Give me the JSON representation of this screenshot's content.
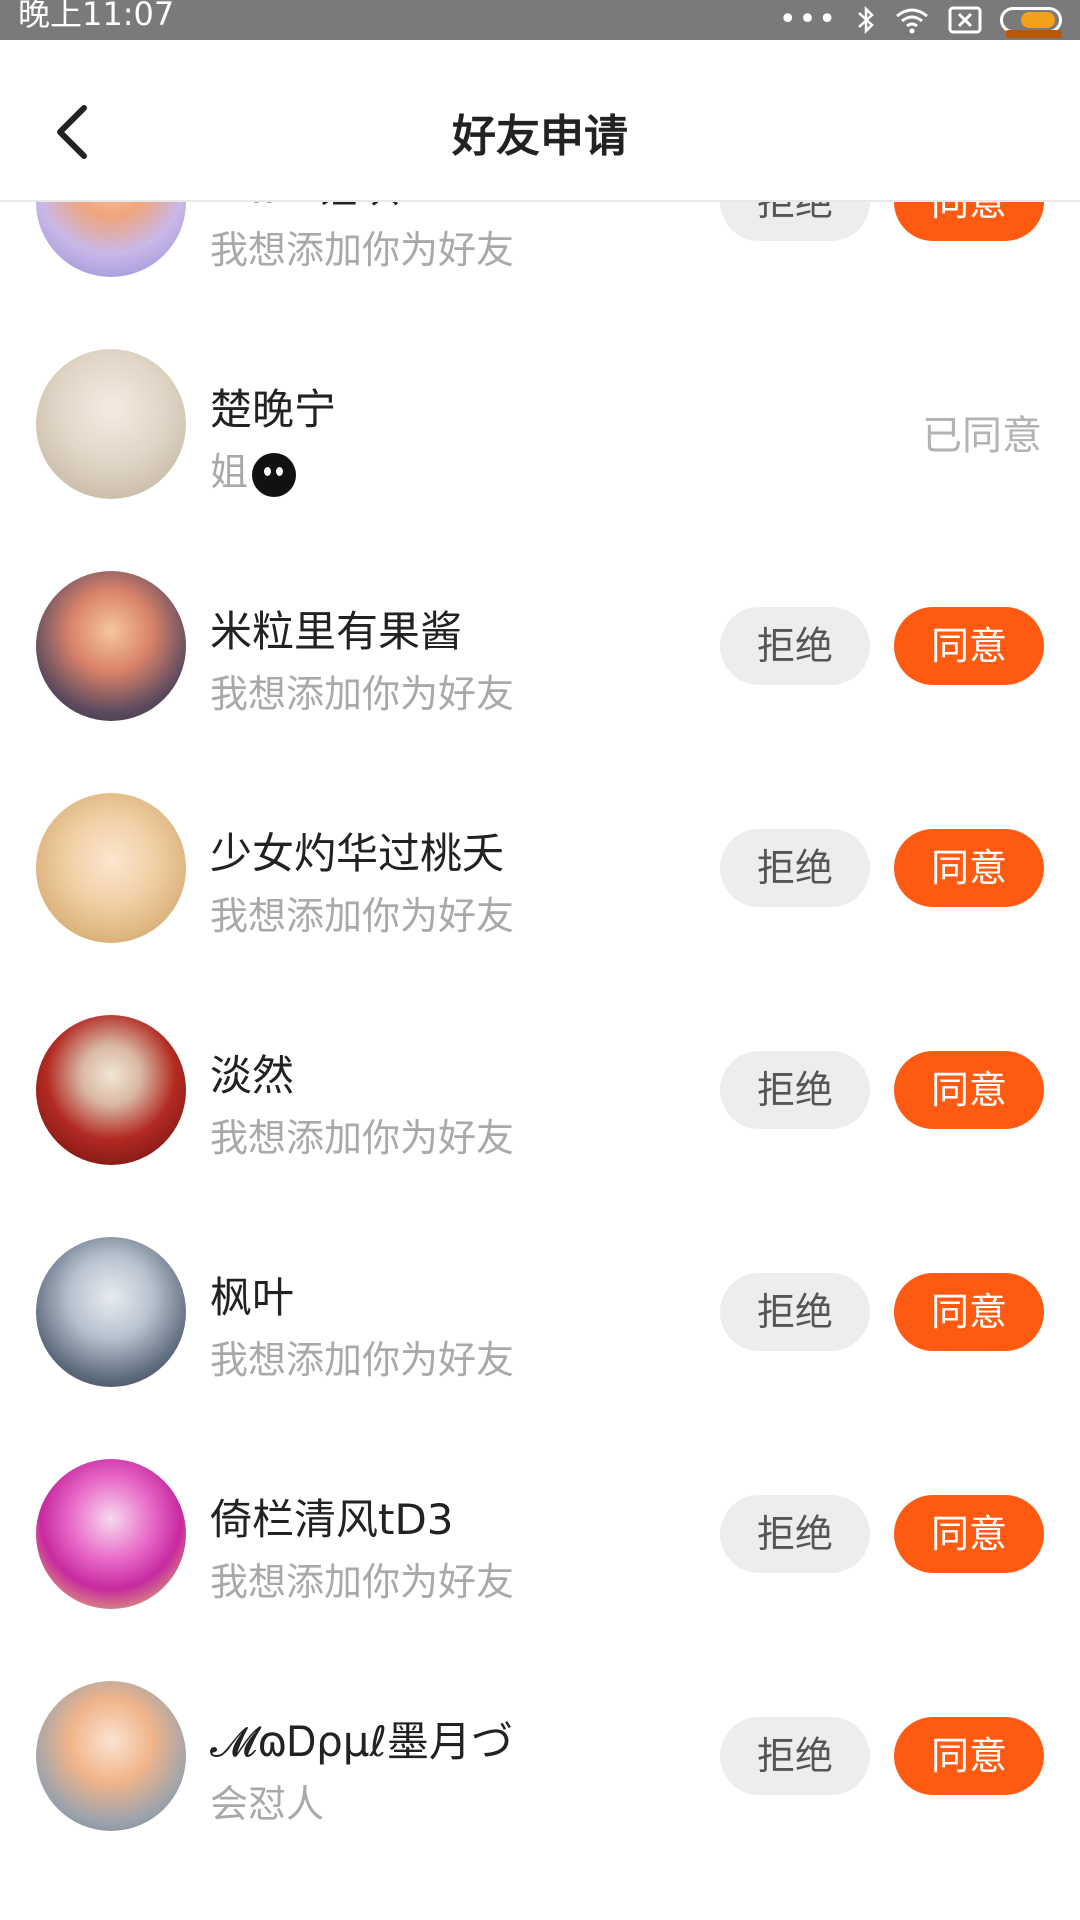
{
  "status_bar": {
    "time": "晚上11:07",
    "dots": "•••"
  },
  "header": {
    "title": "好友申请"
  },
  "labels": {
    "reject": "拒绝",
    "agree": "同意"
  },
  "requests": [
    {
      "name": "^ω^锂琪",
      "message": "我想添加你为好友",
      "status": "pending"
    },
    {
      "name": "楚晚宁",
      "message": "姐",
      "status": "已同意"
    },
    {
      "name": "米粒里有果酱",
      "message": "我想添加你为好友",
      "status": "pending"
    },
    {
      "name": "少女灼华过桃夭",
      "message": "我想添加你为好友",
      "status": "pending"
    },
    {
      "name": "淡然",
      "message": "我想添加你为好友",
      "status": "pending"
    },
    {
      "name": "枫叶",
      "message": "我想添加你为好友",
      "status": "pending"
    },
    {
      "name": "倚栏清风tD3",
      "message": "我想添加你为好友",
      "status": "pending"
    },
    {
      "name": "𝓜ɷᎠρμℓ墨月づ",
      "message": "会怼人",
      "status": "pending"
    }
  ],
  "colors": {
    "accent": "#ff5a12",
    "reject_bg": "#ebedef",
    "status_bar": "#7a7a7a"
  }
}
